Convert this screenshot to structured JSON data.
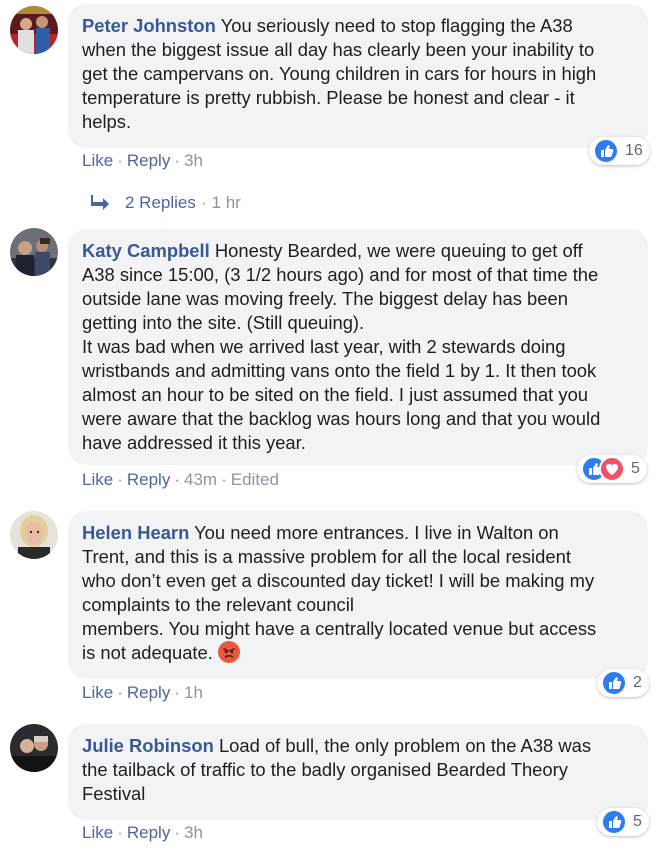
{
  "comments": [
    {
      "author": "Peter Johnston",
      "lines": [
        "You seriously need to stop flagging the A38",
        "when the biggest issue all day has clearly been your inability to",
        "get the campervans on. Young children in cars for hours in high",
        "temperature is pretty rubbish. Please be honest and clear - it",
        "helps."
      ],
      "actions": {
        "like": "Like",
        "reply": "Reply",
        "time": "3h"
      },
      "reaction_count": "16",
      "reaction_icons": [
        "like-icon"
      ],
      "replies": {
        "label": "2 Replies",
        "time": "1 hr"
      }
    },
    {
      "author": "Katy Campbell",
      "lines": [
        "Honesty Bearded, we were queuing to get off",
        "A38 since 15:00, (3 1/2 hours ago) and for most of that time the",
        "outside lane was moving freely. The biggest delay has been",
        "getting into the site. (Still queuing).",
        "It was bad when we arrived last year, with 2 stewards doing",
        "wristbands and admitting vans onto the field 1 by 1. It then took",
        "almost an hour to be sited on the field. I just assumed that you",
        "were aware that the backlog was hours long and that you would",
        "have addressed it this year."
      ],
      "actions": {
        "like": "Like",
        "reply": "Reply",
        "time": "43m",
        "edited": "Edited"
      },
      "reaction_count": "5",
      "reaction_icons": [
        "like-icon",
        "love-icon"
      ]
    },
    {
      "author": "Helen Hearn",
      "lines": [
        "You need more entrances. I live in Walton on",
        "Trent, and this is a massive problem for all the local resident",
        "who don’t even get a discounted day ticket! I will be making my",
        "complaints to the relevant council",
        "members. You might have a centrally located venue but access",
        "is not adequate."
      ],
      "actions": {
        "like": "Like",
        "reply": "Reply",
        "time": "1h"
      },
      "reaction_count": "2",
      "reaction_icons": [
        "like-icon"
      ],
      "emoji": "angry-face-icon"
    },
    {
      "author": "Julie Robinson",
      "lines": [
        "Load of bull, the only problem on the A38 was",
        "the tailback of traffic to the badly organised Bearded Theory",
        "Festival"
      ],
      "actions": {
        "like": "Like",
        "reply": "Reply",
        "time": "3h"
      },
      "reaction_count": "5",
      "reaction_icons": [
        "like-icon"
      ]
    }
  ],
  "separator": "·",
  "colors": {
    "name": "#385898",
    "link": "#4b67a1",
    "bubble": "#f2f3f5",
    "like": "#2d7cf3",
    "love": "#f25268"
  }
}
